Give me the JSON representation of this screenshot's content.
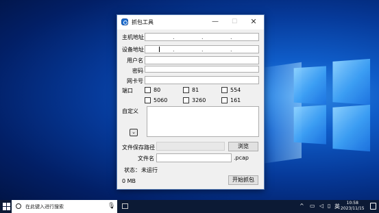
{
  "window": {
    "title": "抓包工具",
    "minimize": "—",
    "maximize": "☐",
    "close": "✕"
  },
  "form": {
    "host_ip_label": "主机地址",
    "device_ip_label": "设备地址",
    "ip_dot": ".",
    "username_label": "用户名",
    "password_label": "密码",
    "nic_label": "网卡号",
    "port_label": "端口",
    "ports": [
      "80",
      "81",
      "554",
      "5060",
      "3260",
      "161"
    ],
    "custom_label": "自定义",
    "dropdown_glyph": "⌄",
    "save_path_label": "文件保存路径",
    "browse_button": "浏览",
    "filename_label": "文件名",
    "filename_ext": ".pcap",
    "status_label": "状态：",
    "status_value": "未运行",
    "size_value": "0 MB",
    "start_button": "开始抓包"
  },
  "taskbar": {
    "search_placeholder": "在此键入进行搜索",
    "mic_icon": "🎙",
    "ime": "英",
    "time": "10:58",
    "date": "2023/11/15",
    "tray_up": "^"
  }
}
